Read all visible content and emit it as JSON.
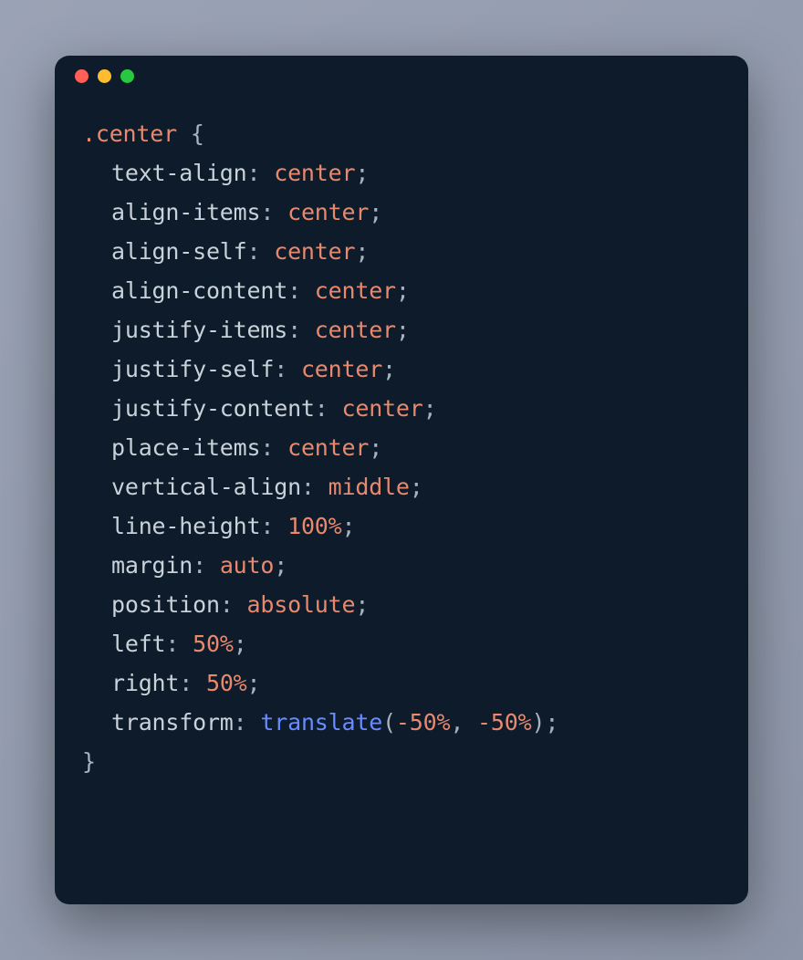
{
  "selector": ".center",
  "brace_open": "{",
  "brace_close": "}",
  "colon": ":",
  "semi": ";",
  "comma": ",",
  "paren_open": "(",
  "paren_close": ")",
  "decls": [
    {
      "prop": "text-align",
      "val": "center"
    },
    {
      "prop": "align-items",
      "val": "center"
    },
    {
      "prop": "align-self",
      "val": "center"
    },
    {
      "prop": "align-content",
      "val": "center"
    },
    {
      "prop": "justify-items",
      "val": "center"
    },
    {
      "prop": "justify-self",
      "val": "center"
    },
    {
      "prop": "justify-content",
      "val": "center"
    },
    {
      "prop": "place-items",
      "val": "center"
    },
    {
      "prop": "vertical-align",
      "val": "middle"
    },
    {
      "prop": "line-height",
      "val": "100%"
    },
    {
      "prop": "margin",
      "val": "auto"
    },
    {
      "prop": "position",
      "val": "absolute"
    },
    {
      "prop": "left",
      "val": "50%"
    },
    {
      "prop": "right",
      "val": "50%"
    }
  ],
  "transform": {
    "prop": "transform",
    "func": "translate",
    "arg1": "-50%",
    "arg2": "-50%"
  }
}
